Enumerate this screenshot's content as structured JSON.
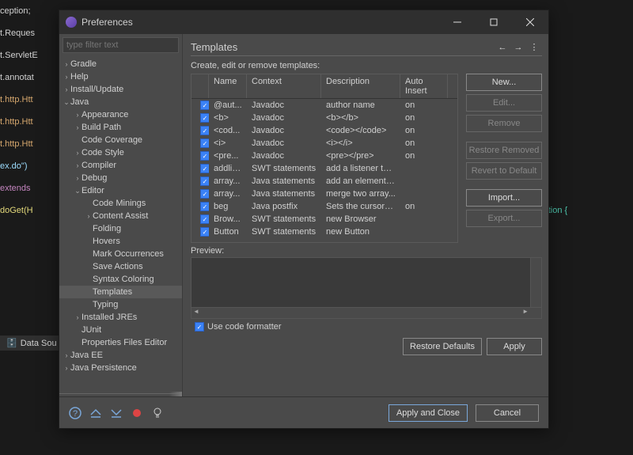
{
  "window": {
    "title": "Preferences"
  },
  "bgcode": {
    "l1": "ception;",
    "l2": "t.Reques",
    "l3": "t.ServletE",
    "l4": "t.annotat",
    "l5": "t.http.Htt",
    "l6": "t.http.Htt",
    "l7": "t.http.Htt",
    "l8": "ex.do\")",
    "l9": "extends",
    "l10": "doGet(H",
    "l11": "OException {",
    "datasrc": "Data Sou"
  },
  "filter": {
    "placeholder": "type filter text"
  },
  "tree": [
    {
      "label": "Gradle",
      "depth": 0,
      "chev": ">"
    },
    {
      "label": "Help",
      "depth": 0,
      "chev": ">"
    },
    {
      "label": "Install/Update",
      "depth": 0,
      "chev": ">"
    },
    {
      "label": "Java",
      "depth": 0,
      "chev": "v"
    },
    {
      "label": "Appearance",
      "depth": 1,
      "chev": ">"
    },
    {
      "label": "Build Path",
      "depth": 1,
      "chev": ">"
    },
    {
      "label": "Code Coverage",
      "depth": 1,
      "chev": ""
    },
    {
      "label": "Code Style",
      "depth": 1,
      "chev": ">"
    },
    {
      "label": "Compiler",
      "depth": 1,
      "chev": ">"
    },
    {
      "label": "Debug",
      "depth": 1,
      "chev": ">"
    },
    {
      "label": "Editor",
      "depth": 1,
      "chev": "v"
    },
    {
      "label": "Code Minings",
      "depth": 2,
      "chev": ""
    },
    {
      "label": "Content Assist",
      "depth": 2,
      "chev": ">"
    },
    {
      "label": "Folding",
      "depth": 2,
      "chev": ""
    },
    {
      "label": "Hovers",
      "depth": 2,
      "chev": ""
    },
    {
      "label": "Mark Occurrences",
      "depth": 2,
      "chev": ""
    },
    {
      "label": "Save Actions",
      "depth": 2,
      "chev": ""
    },
    {
      "label": "Syntax Coloring",
      "depth": 2,
      "chev": ""
    },
    {
      "label": "Templates",
      "depth": 2,
      "chev": "",
      "sel": true
    },
    {
      "label": "Typing",
      "depth": 2,
      "chev": ""
    },
    {
      "label": "Installed JREs",
      "depth": 1,
      "chev": ">"
    },
    {
      "label": "JUnit",
      "depth": 1,
      "chev": ""
    },
    {
      "label": "Properties Files Editor",
      "depth": 1,
      "chev": ""
    },
    {
      "label": "Java EE",
      "depth": 0,
      "chev": ">"
    },
    {
      "label": "Java Persistence",
      "depth": 0,
      "chev": ">"
    }
  ],
  "page": {
    "title": "Templates",
    "desc": "Create, edit or remove templates:",
    "preview": "Preview:",
    "useformatter": "Use code formatter"
  },
  "columns": {
    "c1": "Name",
    "c2": "Context",
    "c3": "Description",
    "c4": "Auto Insert"
  },
  "rows": [
    {
      "name": "@aut...",
      "ctx": "Javadoc",
      "desc": "author name",
      "auto": "on"
    },
    {
      "name": "<b>",
      "ctx": "Javadoc",
      "desc": "<b></b>",
      "auto": "on"
    },
    {
      "name": "<cod...",
      "ctx": "Javadoc",
      "desc": "<code></code>",
      "auto": "on"
    },
    {
      "name": "<i>",
      "ctx": "Javadoc",
      "desc": "<i></i>",
      "auto": "on"
    },
    {
      "name": "<pre...",
      "ctx": "Javadoc",
      "desc": "<pre></pre>",
      "auto": "on"
    },
    {
      "name": "addlis...",
      "ctx": "SWT statements",
      "desc": "add a listener to ...",
      "auto": ""
    },
    {
      "name": "array...",
      "ctx": "Java statements",
      "desc": "add an element t...",
      "auto": ""
    },
    {
      "name": "array...",
      "ctx": "Java statements",
      "desc": "merge two array...",
      "auto": ""
    },
    {
      "name": "beg",
      "ctx": "Java postfix",
      "desc": "Sets the cursor t...",
      "auto": "on"
    },
    {
      "name": "Brow...",
      "ctx": "SWT statements",
      "desc": "new Browser",
      "auto": ""
    },
    {
      "name": "Button",
      "ctx": "SWT statements",
      "desc": "new Button",
      "auto": ""
    }
  ],
  "buttons": {
    "new": "New...",
    "edit": "Edit...",
    "remove": "Remove",
    "restorerem": "Restore Removed",
    "revert": "Revert to Default",
    "import": "Import...",
    "export": "Export...",
    "restoredef": "Restore Defaults",
    "apply": "Apply",
    "applyclose": "Apply and Close",
    "cancel": "Cancel"
  }
}
